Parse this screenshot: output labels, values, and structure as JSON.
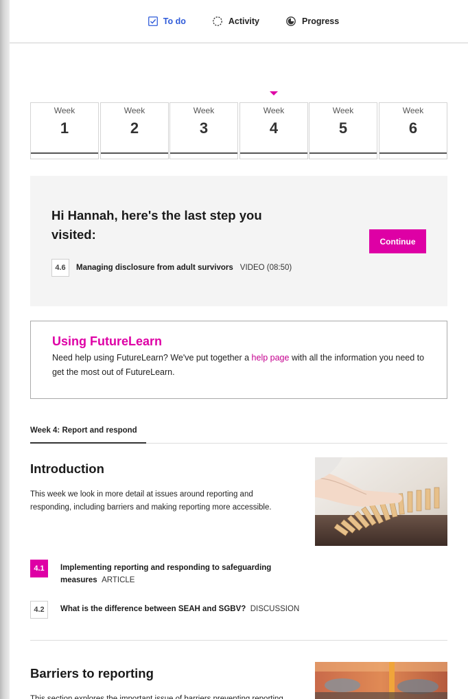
{
  "topnav": {
    "tabs": [
      {
        "label": "To do",
        "icon": "checkbox-icon",
        "active": true
      },
      {
        "label": "Activity",
        "icon": "activity-icon",
        "active": false
      },
      {
        "label": "Progress",
        "icon": "progress-icon",
        "active": false
      }
    ]
  },
  "weeks": {
    "label": "Week",
    "items": [
      "1",
      "2",
      "3",
      "4",
      "5",
      "6"
    ],
    "selected": "4"
  },
  "last_step": {
    "heading": "Hi Hannah, here's the last step you visited:",
    "continue_label": "Continue",
    "step_number": "4.6",
    "step_title": "Managing disclosure from adult survivors",
    "step_type": "VIDEO (08:50)"
  },
  "help": {
    "title": "Using FutureLearn",
    "text_before": "Need help using FutureLearn? We've put together a ",
    "link": "help page",
    "text_after": " with all the information you need to get the most out of FutureLearn."
  },
  "week_section": {
    "heading": "Week 4: Report and respond"
  },
  "sections": [
    {
      "title": "Introduction",
      "description": "This week we look in more detail at issues around reporting and responding, including barriers and making reporting more accessible.",
      "steps": [
        {
          "number": "4.1",
          "title": "Implementing reporting and responding to safeguarding measures",
          "type": "ARTICLE",
          "current": true
        },
        {
          "number": "4.2",
          "title": "What is the difference between SEAH and SGBV?",
          "type": "DISCUSSION",
          "current": false
        }
      ]
    },
    {
      "title": "Barriers to reporting",
      "description": "This section explores the important issue of barriers preventing reporting of"
    }
  ],
  "colors": {
    "accent": "#de00a5",
    "tab_active": "#2f5bd9"
  }
}
